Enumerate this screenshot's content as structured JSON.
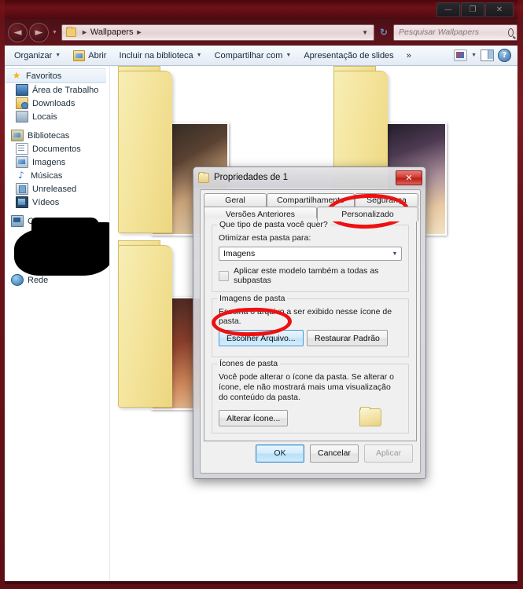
{
  "window": {
    "controls": {
      "minimize": "—",
      "maximize": "❐",
      "close": "✕"
    }
  },
  "address": {
    "back_icon": "◄",
    "forward_icon": "►",
    "history_caret": "▼",
    "folder_icon": "folder-icon",
    "separator": "►",
    "path": "Wallpapers",
    "trailing_separator": "►",
    "dropdown_caret": "▼",
    "refresh_icon": "↻"
  },
  "search": {
    "placeholder": "Pesquisar Wallpapers",
    "value": "",
    "icon": "search-icon"
  },
  "toolbar": {
    "organizar": "Organizar",
    "abrir": "Abrir",
    "incluir": "Incluir na biblioteca",
    "compartilhar": "Compartilhar com",
    "slides": "Apresentação de slides",
    "overflow": "»",
    "caret": "▼",
    "help_glyph": "?"
  },
  "sidebar": {
    "groups": [
      {
        "root": {
          "label": "Favoritos",
          "icon": "star-icon",
          "selected": true
        },
        "items": [
          {
            "label": "Área de Trabalho",
            "icon": "desktop-icon"
          },
          {
            "label": "Downloads",
            "icon": "downloads-icon"
          },
          {
            "label": "Locais",
            "icon": "places-icon"
          }
        ]
      },
      {
        "root": {
          "label": "Bibliotecas",
          "icon": "library-icon",
          "selected": false
        },
        "items": [
          {
            "label": "Documentos",
            "icon": "document-icon"
          },
          {
            "label": "Imagens",
            "icon": "pictures-icon"
          },
          {
            "label": "Músicas",
            "icon": "music-icon"
          },
          {
            "label": "Unreleased",
            "icon": "library-folder-icon"
          },
          {
            "label": "Vídeos",
            "icon": "video-icon"
          }
        ]
      },
      {
        "root": {
          "label": "Computador",
          "icon": "computer-icon",
          "selected": false
        },
        "items": []
      },
      {
        "root": {
          "label": "Rede",
          "icon": "network-icon",
          "selected": false
        },
        "items": []
      }
    ]
  },
  "dialog": {
    "title": "Propriedades de 1",
    "title_icon": "folder-icon",
    "close_label": "✕",
    "tabs": [
      {
        "id": "geral",
        "label": "Geral",
        "active": false
      },
      {
        "id": "compartilhamento",
        "label": "Compartilhamento",
        "active": false
      },
      {
        "id": "seguranca",
        "label": "Segurança",
        "active": false
      },
      {
        "id": "versoes",
        "label": "Versões Anteriores",
        "active": false
      },
      {
        "id": "personalizado",
        "label": "Personalizado",
        "active": true
      }
    ],
    "folder_type": {
      "group_title": "Que tipo de pasta você quer?",
      "field_label": "Otimizar esta pasta para:",
      "combo_value": "Imagens",
      "combo_caret": "▼",
      "checkbox_label": "Aplicar este modelo também a todas as subpastas",
      "checkbox_checked": false
    },
    "folder_pictures": {
      "group_title": "Imagens de pasta",
      "description": "Escolha o arquivo a ser exibido nesse ícone de pasta.",
      "choose_button": "Escolher Arquivo...",
      "restore_button": "Restaurar Padrão"
    },
    "folder_icons": {
      "group_title": "Ícones de pasta",
      "description": "Você pode alterar o ícone da pasta. Se alterar o ícone, ele não mostrará mais uma visualização do conteúdo da pasta.",
      "change_button": "Alterar Ícone...",
      "preview_icon": "folder-icon"
    },
    "buttons": {
      "ok": "OK",
      "cancel": "Cancelar",
      "apply": "Aplicar",
      "apply_disabled": true
    }
  },
  "annotations": {
    "color": "#ee1111",
    "circles": [
      {
        "target": "personalizado-tab"
      },
      {
        "target": "escolher-arquivo-button"
      }
    ]
  }
}
